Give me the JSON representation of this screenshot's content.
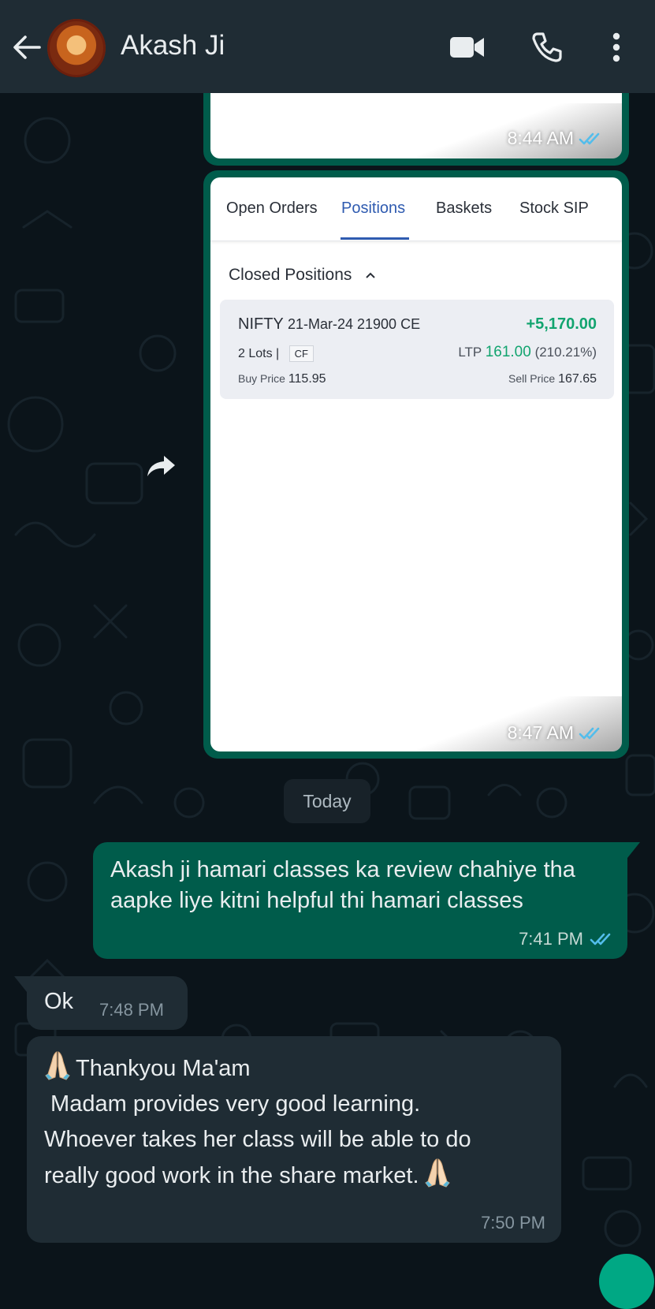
{
  "header": {
    "contact_name": "Akash Ji",
    "icons": [
      "back-arrow-icon",
      "avatar",
      "video-call-icon",
      "voice-call-icon",
      "more-options-icon"
    ]
  },
  "messages": {
    "image1": {
      "time": "8:44 AM",
      "status": "read"
    },
    "image2": {
      "time": "8:47 AM",
      "status": "read",
      "screenshot": {
        "tabs": [
          "Open Orders",
          "Positions",
          "Baskets",
          "Stock SIP"
        ],
        "active_tab": "Positions",
        "section_title": "Closed Positions",
        "position": {
          "symbol": "NIFTY",
          "expiry_strike": "21-Mar-24 21900 CE",
          "pnl": "+5,170.00",
          "lots": "2 Lots |",
          "badge": "CF",
          "ltp_label": "LTP",
          "ltp_value": "161.00",
          "ltp_change": "(210.21%)",
          "buy_label": "Buy Price",
          "buy_value": "115.95",
          "sell_label": "Sell Price",
          "sell_value": "167.65"
        }
      }
    },
    "date_divider": "Today",
    "outgoing": {
      "text": "Akash ji hamari classes ka review chahiye tha aapke liye kitni helpful thi hamari classes",
      "time": "7:41 PM",
      "status": "read"
    },
    "incoming_ok": {
      "text": "Ok",
      "time": "7:48 PM"
    },
    "incoming_thanks": {
      "line1": "Thankyou Ma'am",
      "line2": " Madam provides very good learning.",
      "line3": "Whoever takes her class will be able to do",
      "line4": "really good work in the share market.",
      "time": "7:50 PM"
    }
  },
  "colors": {
    "background": "#0b141a",
    "header": "#1f2c34",
    "outgoing_bubble": "#005c4b",
    "incoming_bubble": "#1f2c34",
    "read_tick": "#53bdeb",
    "profit_green": "#12a46f",
    "active_tab_blue": "#2f5bb0"
  }
}
